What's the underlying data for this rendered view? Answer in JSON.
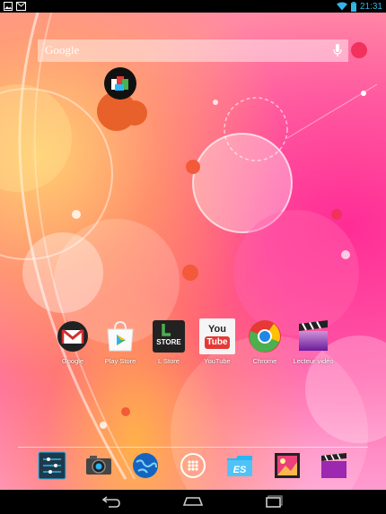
{
  "status": {
    "time": "21:31"
  },
  "search": {
    "label": "Google"
  },
  "apps": [
    {
      "name": "Google"
    },
    {
      "name": "Play Store"
    },
    {
      "name": "L Store",
      "badge": "STORE"
    },
    {
      "name": "YouTube",
      "logo_top": "You",
      "logo_bottom": "Tube"
    },
    {
      "name": "Chrome"
    },
    {
      "name": "Lecteur vidéo"
    }
  ],
  "dock": [
    "settings-icon",
    "camera-icon",
    "globe-icon",
    "app-drawer-icon",
    "es-file-explorer-icon",
    "gallery-icon",
    "video-player-icon"
  ],
  "dock_labels": {
    "es": "ES"
  },
  "colors": {
    "accent": "#33b5e5"
  }
}
